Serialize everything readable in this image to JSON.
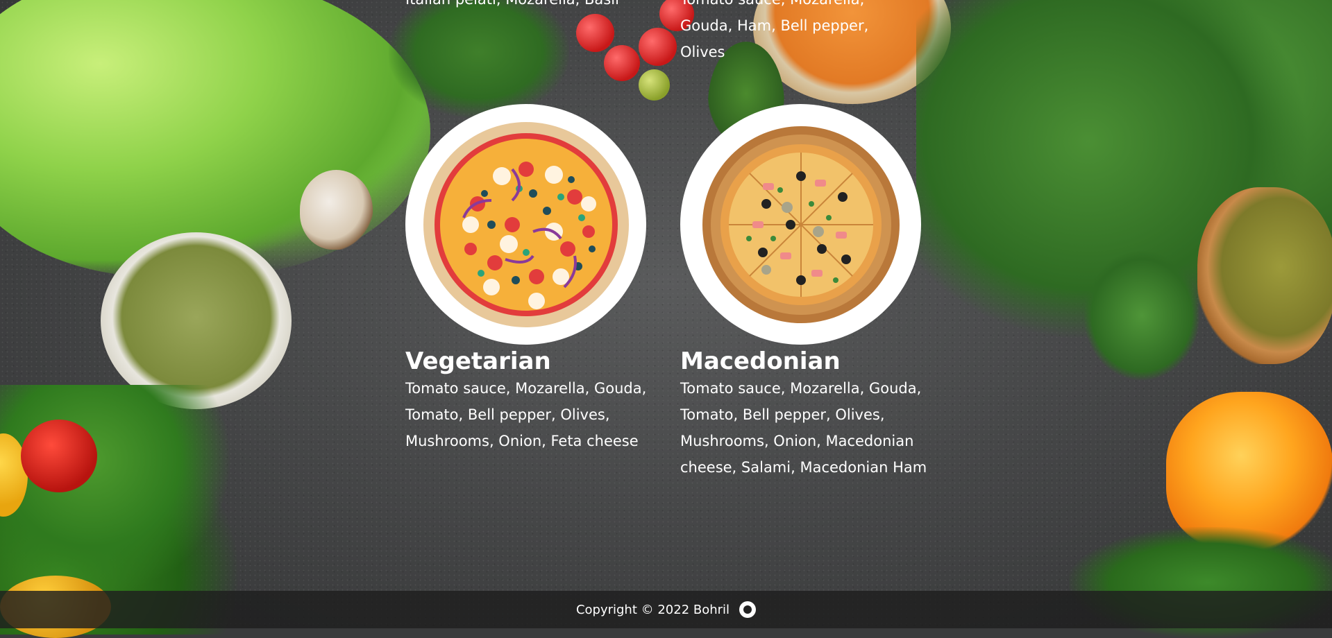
{
  "top_cards": [
    {
      "ingredients_partial": "Italian pelati, Mozarella, Basil"
    },
    {
      "ingredients_partial": "Tomato sauce, Mozarella, Gouda, Ham, Bell pepper, Olives"
    }
  ],
  "pizzas": [
    {
      "name": "Vegetarian",
      "ingredients": "Tomato sauce, Mozarella, Gouda, Tomato, Bell pepper, Olives, Mushrooms, Onion, Feta cheese"
    },
    {
      "name": "Macedonian",
      "ingredients": "Tomato sauce, Mozarella, Gouda, Tomato, Bell pepper, Olives, Mushrooms, Onion, Macedonian cheese, Salami, Macedonian Ham"
    }
  ],
  "footer": {
    "copyright": "Copyright © 2022 Bohril",
    "icon": "github-icon"
  }
}
